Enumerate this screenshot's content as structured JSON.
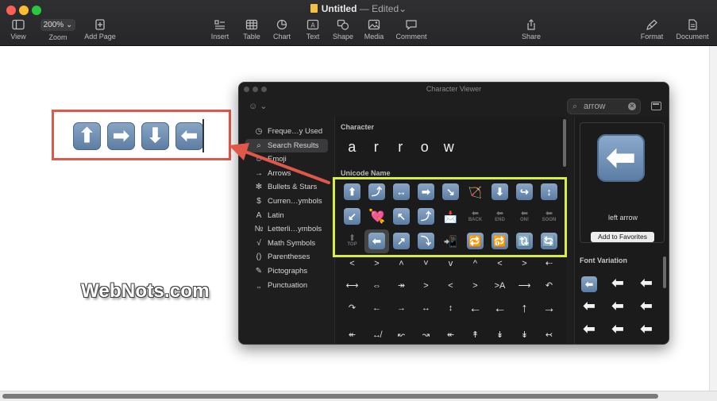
{
  "window": {
    "doc_name": "Untitled",
    "dash": "—",
    "status": "Edited"
  },
  "toolbar": {
    "view": "View",
    "zoom_value": "200%",
    "zoom": "Zoom",
    "add_page": "Add Page",
    "insert": "Insert",
    "table": "Table",
    "chart": "Chart",
    "text": "Text",
    "shape": "Shape",
    "media": "Media",
    "comment": "Comment",
    "share": "Share",
    "format": "Format",
    "document": "Document"
  },
  "canvas": {
    "emoji_keys": [
      "⬆",
      "➡",
      "⬇",
      "⬅"
    ],
    "watermark": "WebNots.com"
  },
  "character_viewer": {
    "title": "Character Viewer",
    "search_value": "arrow",
    "sidebar": [
      {
        "icon": "◷",
        "label": "Freque…y Used"
      },
      {
        "icon": "⌕",
        "label": "Search Results"
      },
      {
        "icon": "☺",
        "label": "Emoji"
      },
      {
        "icon": "→",
        "label": "Arrows"
      },
      {
        "icon": "✻",
        "label": "Bullets & Stars"
      },
      {
        "icon": "$",
        "label": "Curren…ymbols"
      },
      {
        "icon": "A",
        "label": "Latin"
      },
      {
        "icon": "№",
        "label": "Letterli…ymbols"
      },
      {
        "icon": "√",
        "label": "Math Symbols"
      },
      {
        "icon": "()",
        "label": "Parentheses"
      },
      {
        "icon": "✎",
        "label": "Pictographs"
      },
      {
        "icon": "‚‚",
        "label": "Punctuation"
      }
    ],
    "section_character": "Character",
    "character_letters": [
      "a",
      "r",
      "r",
      "o",
      "w"
    ],
    "section_unicode": "Unicode Name",
    "emoji_grid": [
      [
        "⬆",
        "⤴",
        "↔",
        "➡",
        "↘",
        "🏹",
        "⬇",
        "↪",
        "↕"
      ],
      [
        "↙",
        "💘",
        "↖",
        "⤴",
        "📩",
        "BACK",
        "END",
        "ON!",
        "SOON"
      ],
      [
        "TOP",
        "⬅",
        "↗",
        "⤵",
        "📲",
        "🔁",
        "🔂",
        "🔃",
        "🔄"
      ]
    ],
    "symbol_rows": [
      [
        "˂",
        "˃",
        "˄",
        "˅",
        "v",
        "^",
        "<",
        ">",
        "⇠"
      ],
      [
        "⟷",
        "⇔",
        "↠",
        ">",
        "<",
        ">",
        ">A",
        "⟶",
        "↶"
      ],
      [
        "↷",
        "←",
        "→",
        "↔",
        "↕",
        "←",
        "←",
        "↑",
        "→"
      ],
      [
        "↞",
        "↮",
        "↜",
        "↝",
        "↞",
        "↟",
        "↡",
        "↡",
        "↢"
      ]
    ],
    "preview_char": "⬅",
    "preview_name": "left arrow",
    "add_favorites": "Add to Favorites",
    "section_font_variation": "Font Variation",
    "font_variations": [
      "⬅",
      "⬅",
      "⬅",
      "⬅",
      "⬅",
      "⬅",
      "⬅",
      "⬅",
      "⬅",
      "⬅",
      "⬅",
      "⬅"
    ]
  }
}
